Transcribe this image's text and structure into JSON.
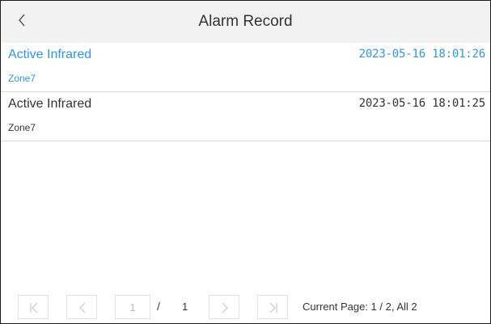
{
  "header": {
    "title": "Alarm Record",
    "back_icon": "chevron-left-icon"
  },
  "records": [
    {
      "type": "Active Infrared",
      "time": "2023-05-16 18:01:26",
      "zone": "Zone7",
      "selected": true
    },
    {
      "type": "Active Infrared",
      "time": "2023-05-16 18:01:25",
      "zone": "Zone7",
      "selected": false
    }
  ],
  "pagination": {
    "page_input_value": "1",
    "slash": "/",
    "total_pages": "1",
    "info": "Current Page: 1 / 2, All 2",
    "icons": {
      "first": "first-page-icon",
      "prev": "chevron-left-icon",
      "next": "chevron-right-icon",
      "last": "last-page-icon"
    }
  },
  "colors": {
    "accent": "#2f95ea",
    "header_bg": "#f2f2f2",
    "text": "#333333",
    "divider": "#d9d9d9",
    "disabled": "#c8c8c8"
  }
}
